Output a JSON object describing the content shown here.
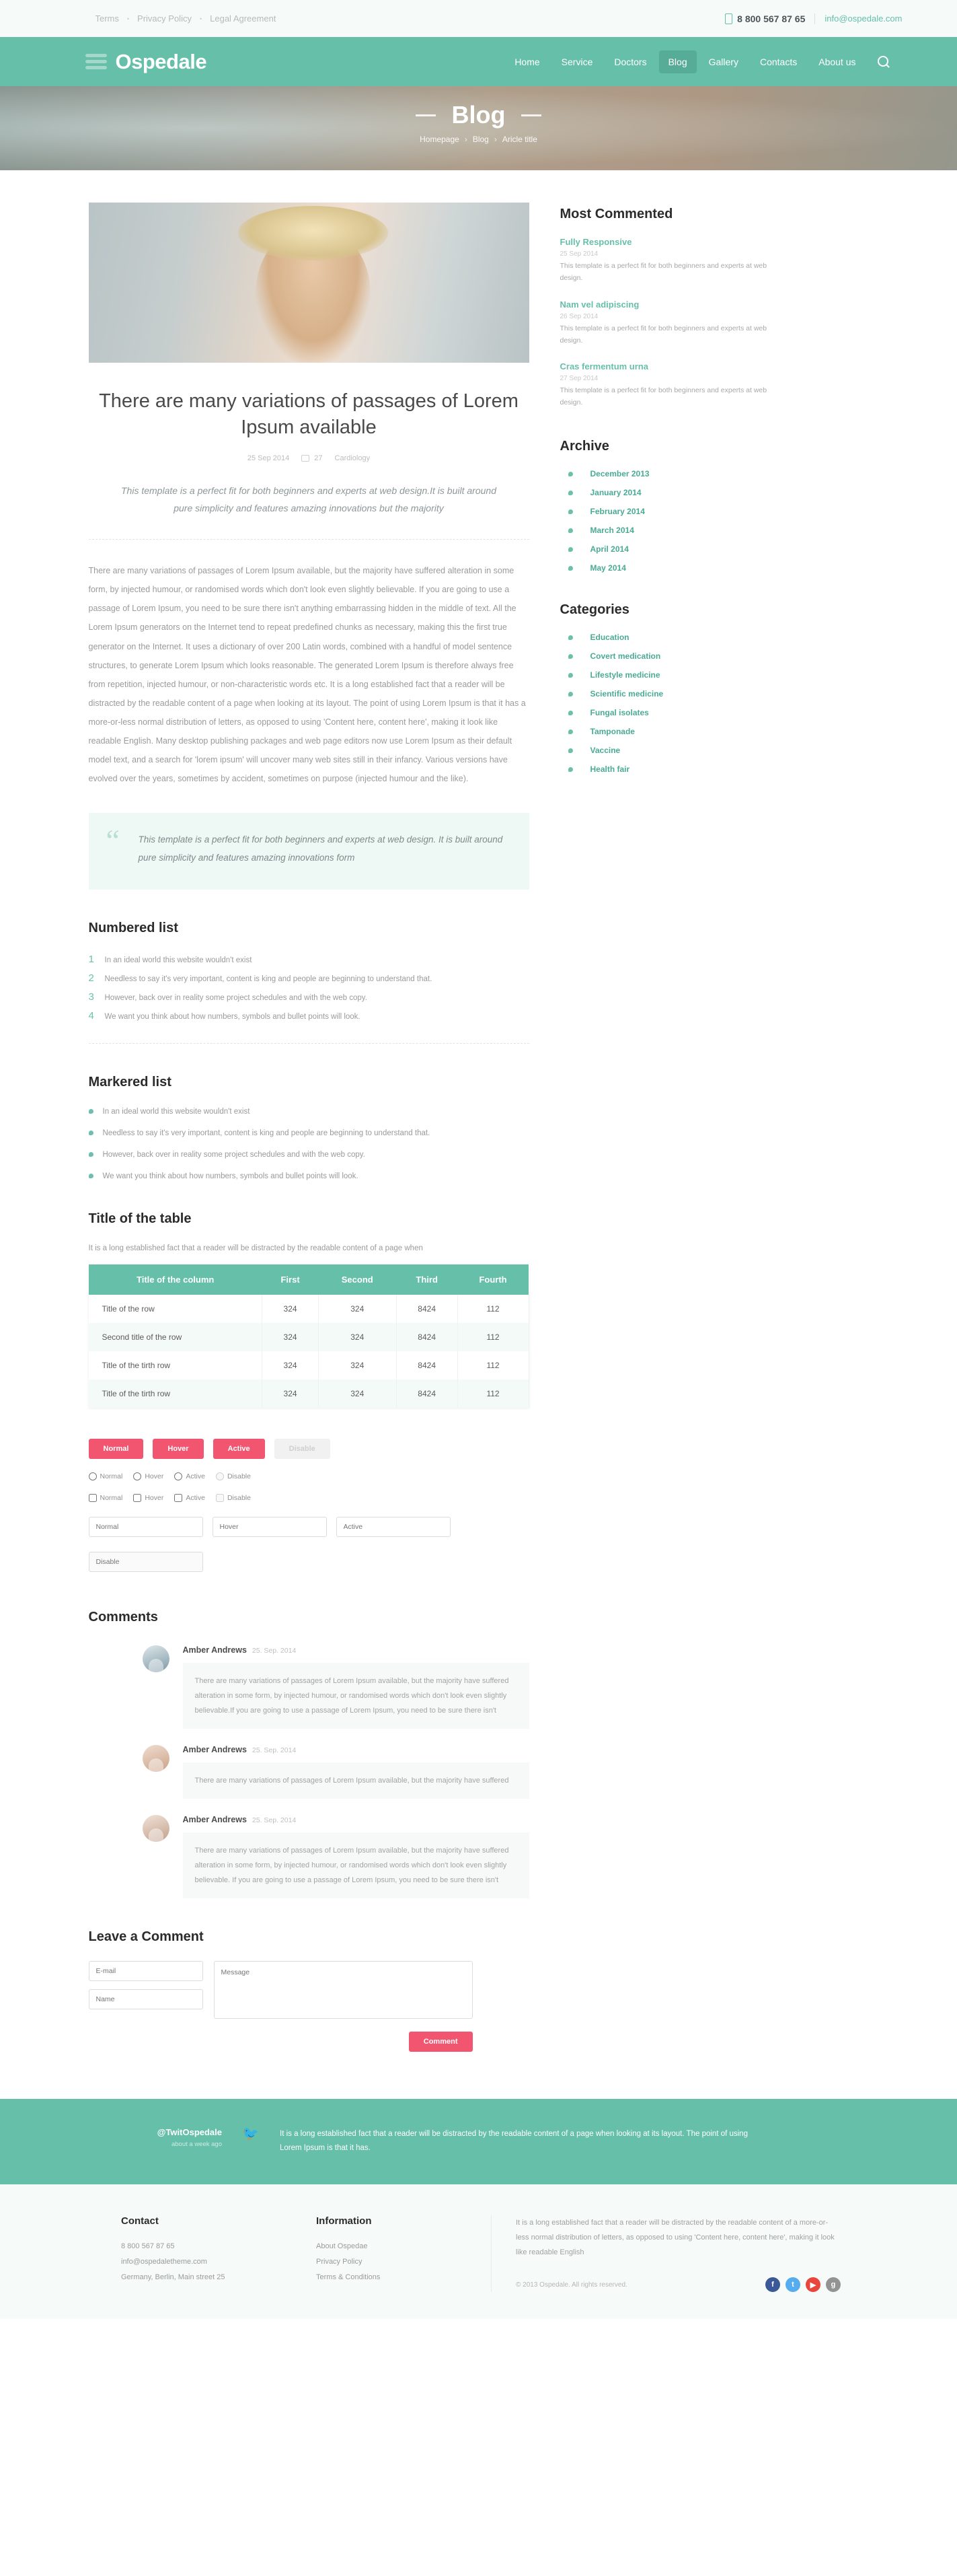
{
  "topbar": {
    "links": [
      "Terms",
      "Privacy Policy",
      "Legal Agreement"
    ],
    "phone": "8 800 567 87 65",
    "email": "info@ospedale.com"
  },
  "header": {
    "logo": "Ospedale",
    "nav": [
      {
        "label": "Home",
        "active": false
      },
      {
        "label": "Service",
        "active": false
      },
      {
        "label": "Doctors",
        "active": false
      },
      {
        "label": "Blog",
        "active": true
      },
      {
        "label": "Gallery",
        "active": false
      },
      {
        "label": "Contacts",
        "active": false
      },
      {
        "label": "About us",
        "active": false
      }
    ]
  },
  "hero": {
    "title": "Blog",
    "breadcrumb": [
      "Homepage",
      "Blog",
      "Aricle title"
    ]
  },
  "post": {
    "title": "There are many variations of passages of Lorem Ipsum available",
    "date": "25 Sep 2014",
    "comments_count": "27",
    "category": "Cardiology",
    "lead": "This template is a perfect fit for both beginners and experts at web design.It is built around pure simplicity and features amazing innovations but the majority",
    "body": "There are many variations of passages of Lorem Ipsum available, but the majority have suffered alteration in some form, by injected humour, or randomised words which don't look even slightly believable. If you are going to use a passage of Lorem Ipsum, you need to be sure there isn't anything embarrassing hidden in the middle of text. All the Lorem Ipsum generators on the Internet tend to repeat predefined chunks as necessary, making this the first true generator on the Internet. It uses a dictionary of over 200 Latin words, combined with a handful of model sentence structures, to generate Lorem Ipsum which looks reasonable. The generated Lorem Ipsum is therefore always free from repetition, injected humour, or non-characteristic words etc. It is a long established fact that a reader will be distracted by the readable content of a page when looking at its layout. The point of using Lorem Ipsum is that it has a more-or-less normal distribution of letters, as opposed to using 'Content here, content here', making it look like readable English. Many desktop publishing packages and web page editors now use Lorem Ipsum as their default model text, and a search for 'lorem ipsum' will uncover many web sites still in their infancy. Various versions have evolved over the years, sometimes by accident, sometimes on purpose (injected humour and the like).",
    "quote": "This template is a perfect fit for both beginners and experts at web design. It is built around pure simplicity and features amazing innovations form"
  },
  "numbered": {
    "heading": "Numbered list",
    "items": [
      "In an ideal world this website wouldn't exist",
      "Needless to say it's very important, content is king and people are beginning to understand that.",
      "However, back over in reality some project schedules and with the web copy.",
      "We want you think about how numbers, symbols and bullet points will look."
    ]
  },
  "markered": {
    "heading": "Markered list",
    "items": [
      "In an ideal world this website wouldn't exist",
      "Needless to say it's very important, content is king and people are beginning to understand that.",
      "However, back over in reality some project schedules and with the web copy.",
      "We want you think about how numbers, symbols and bullet points will look."
    ]
  },
  "table_section": {
    "heading": "Title of the table",
    "note": "It is a long established fact that a reader will be distracted by the readable content of a page when",
    "columns": [
      "Title of the column",
      "First",
      "Second",
      "Third",
      "Fourth"
    ],
    "rows": [
      [
        "Title of the row",
        "324",
        "324",
        "8424",
        "112"
      ],
      [
        "Second title of the row",
        "324",
        "324",
        "8424",
        "112"
      ],
      [
        "Title of the tirth row",
        "324",
        "324",
        "8424",
        "112"
      ],
      [
        "Title of the tirth row",
        "324",
        "324",
        "8424",
        "112"
      ]
    ]
  },
  "controls": {
    "buttons": [
      {
        "label": "Normal",
        "state": "normal"
      },
      {
        "label": "Hover",
        "state": "hover"
      },
      {
        "label": "Active",
        "state": "active"
      },
      {
        "label": "Disable",
        "state": "disable"
      }
    ],
    "radios": [
      "Normal",
      "Hover",
      "Active",
      "Disable"
    ],
    "checkboxes": [
      "Normal",
      "Hover",
      "Active",
      "Disable"
    ],
    "inputs": [
      "Normal",
      "Hover",
      "Active",
      "Disable"
    ]
  },
  "comments": {
    "heading": "Comments",
    "items": [
      {
        "name": "Amber Andrews",
        "date": "25. Sep. 2014",
        "text": "There are many variations of passages of Lorem Ipsum available, but the majority have suffered alteration in some form, by injected humour, or randomised words which don't look even slightly believable.If you are going to use a passage of Lorem Ipsum, you need to be sure there isn't"
      },
      {
        "name": "Amber Andrews",
        "date": "25. Sep. 2014",
        "text": "There are many variations of passages of Lorem Ipsum available, but the majority have suffered"
      },
      {
        "name": "Amber Andrews",
        "date": "25. Sep. 2014",
        "text": "There are many variations of passages of Lorem Ipsum available, but the majority have suffered alteration in some form, by injected humour, or randomised words which don't look even slightly believable. If you are going to use a passage of Lorem Ipsum, you need to be sure there isn't"
      }
    ]
  },
  "leave_comment": {
    "heading": "Leave a Comment",
    "email_placeholder": "E-mail",
    "name_placeholder": "Name",
    "message_placeholder": "Message",
    "submit_label": "Comment"
  },
  "sidebar": {
    "most_commented_heading": "Most Commented",
    "most_commented": [
      {
        "title": "Fully Responsive",
        "date": "25 Sep 2014",
        "text": "This template is a perfect fit for both beginners and experts at web design."
      },
      {
        "title": "Nam vel adipiscing",
        "date": "26 Sep 2014",
        "text": "This template is a perfect fit for both beginners and experts at web design."
      },
      {
        "title": "Cras fermentum urna",
        "date": "27 Sep 2014",
        "text": "This template is a perfect fit for both beginners and experts at web design."
      }
    ],
    "archive_heading": "Archive",
    "archive": [
      "December 2013",
      "January 2014",
      "February 2014",
      "March 2014",
      "April 2014",
      "May 2014"
    ],
    "categories_heading": "Categories",
    "categories": [
      "Education",
      "Covert medication",
      "Lifestyle medicine",
      "Scientific medicine",
      "Fungal isolates",
      "Tamponade",
      "Vaccine",
      "Health fair"
    ]
  },
  "twitter": {
    "handle": "@TwitOspedale",
    "sub": "about a week ago",
    "text": "It is a long established fact that a reader will be distracted by the readable content of a page when looking at its layout. The point of using Lorem Ipsum is that it has."
  },
  "footer": {
    "contact_heading": "Contact",
    "contact_phone": "8 800 567 87 65",
    "contact_email": "info@ospedaletheme.com",
    "contact_address": "Germany, Berlin, Main street 25",
    "info_heading": "Information",
    "info_links": [
      "About Ospedae",
      "Privacy Policy",
      "Terms & Conditions"
    ],
    "about_text": "It is a long established fact that a reader will be distracted by the readable content of a more-or-less normal distribution of letters, as opposed to using 'Content here, content here', making it look like readable English",
    "copyright": "© 2013 Ospedale. All rights reserved.",
    "socials": [
      "facebook-icon",
      "twitter-icon",
      "youtube-icon",
      "google-plus-icon"
    ]
  },
  "colors": {
    "primary": "#66bfa9",
    "accent": "#f2556f",
    "topbar_bg": "#f6fbfa"
  }
}
